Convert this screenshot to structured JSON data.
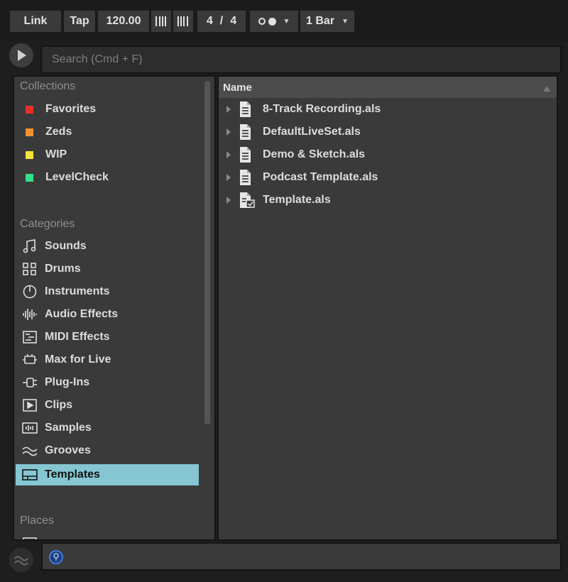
{
  "transport": {
    "link": "Link",
    "tap": "Tap",
    "tempo": "120.00",
    "signature_num": "4",
    "signature_sep": "/",
    "signature_den": "4",
    "quantize": "1 Bar"
  },
  "search": {
    "placeholder": "Search (Cmd + F)"
  },
  "sidebar": {
    "collections_title": "Collections",
    "collections": [
      {
        "label": "Favorites",
        "color": "#e8302a"
      },
      {
        "label": "Zeds",
        "color": "#f09232"
      },
      {
        "label": "WIP",
        "color": "#f2e43c"
      },
      {
        "label": "LevelCheck",
        "color": "#33e08a"
      }
    ],
    "categories_title": "Categories",
    "categories": [
      {
        "label": "Sounds",
        "icon": "music-note-icon"
      },
      {
        "label": "Drums",
        "icon": "drum-grid-icon"
      },
      {
        "label": "Instruments",
        "icon": "power-dial-icon"
      },
      {
        "label": "Audio Effects",
        "icon": "waveform-icon"
      },
      {
        "label": "MIDI Effects",
        "icon": "midi-lines-icon"
      },
      {
        "label": "Max for Live",
        "icon": "max-device-icon"
      },
      {
        "label": "Plug-Ins",
        "icon": "plug-icon"
      },
      {
        "label": "Clips",
        "icon": "clip-play-icon"
      },
      {
        "label": "Samples",
        "icon": "sample-wave-icon"
      },
      {
        "label": "Grooves",
        "icon": "groove-wave-icon"
      },
      {
        "label": "Templates",
        "icon": "template-icon",
        "selected": true
      }
    ],
    "places_title": "Places"
  },
  "files": {
    "column_name": "Name",
    "items": [
      {
        "name": "8-Track Recording.als"
      },
      {
        "name": "DefaultLiveSet.als"
      },
      {
        "name": "Demo & Sketch.als"
      },
      {
        "name": "Podcast Template.als"
      },
      {
        "name": "Template.als"
      }
    ]
  },
  "colors": {
    "selection": "#85c6d2",
    "panel": "#3a3a3a",
    "background": "#1e1e1e"
  }
}
